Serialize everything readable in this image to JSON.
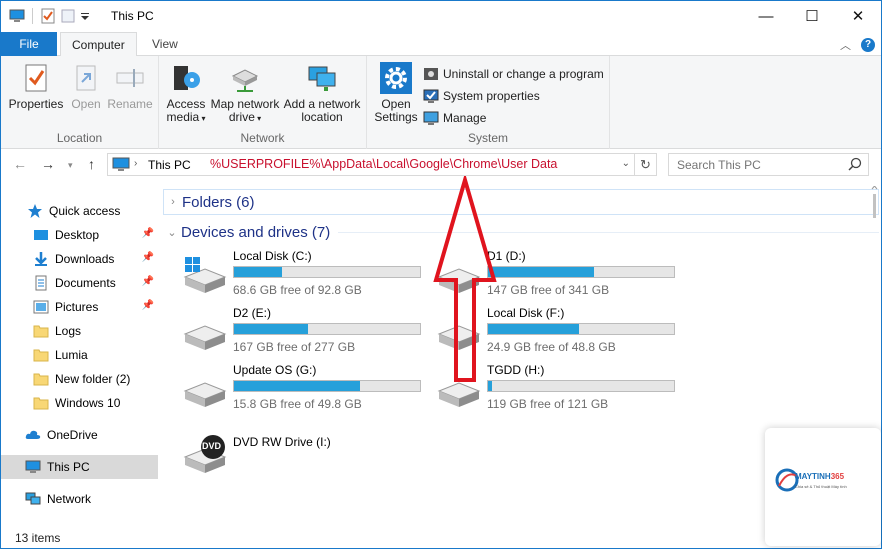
{
  "window": {
    "title": "This PC",
    "minimize": "—",
    "maximize": "☐",
    "close": "✕"
  },
  "tabs": {
    "file": "File",
    "computer": "Computer",
    "view": "View",
    "help": "?"
  },
  "ribbon": {
    "location": {
      "label": "Location",
      "properties": "Properties",
      "open": "Open",
      "rename": "Rename"
    },
    "network": {
      "label": "Network",
      "access_media": "Access media",
      "map_drive": "Map network drive",
      "add_location": "Add a network location"
    },
    "system": {
      "label": "System",
      "open_settings": "Open Settings",
      "uninstall": "Uninstall or change a program",
      "sys_props": "System properties",
      "manage": "Manage"
    }
  },
  "address": {
    "crumb": "This PC",
    "path": "%USERPROFILE%\\AppData\\Local\\Google\\Chrome\\User Data",
    "search_placeholder": "Search This PC"
  },
  "nav": {
    "quick_access": "Quick access",
    "items": [
      "Desktop",
      "Downloads",
      "Documents",
      "Pictures",
      "Logs",
      "Lumia",
      "New folder (2)",
      "Windows 10"
    ],
    "onedrive": "OneDrive",
    "this_pc": "This PC",
    "network": "Network"
  },
  "content": {
    "folders": "Folders (6)",
    "devices": "Devices and drives (7)",
    "drives": [
      {
        "name": "Local Disk (C:)",
        "free": "68.6 GB free of 92.8 GB",
        "used_fraction": 0.26
      },
      {
        "name": "D1 (D:)",
        "free": "147 GB free of 341 GB",
        "used_fraction": 0.57
      },
      {
        "name": "D2 (E:)",
        "free": "167 GB free of 277 GB",
        "used_fraction": 0.4
      },
      {
        "name": "Local Disk (F:)",
        "free": "24.9 GB free of 48.8 GB",
        "used_fraction": 0.49
      },
      {
        "name": "Update OS (G:)",
        "free": "15.8 GB free of 49.8 GB",
        "used_fraction": 0.68
      },
      {
        "name": "TGDD (H:)",
        "free": "119 GB free of 121 GB",
        "used_fraction": 0.02
      },
      {
        "name": "DVD RW Drive (I:)",
        "free": "",
        "used_fraction": null
      }
    ],
    "dvd_badge": "DVD"
  },
  "status": {
    "items": "13 items"
  },
  "watermark": {
    "brand_a": "MAYTINH",
    "brand_b": "365",
    "tagline": "Chia sẻ & Thủ thuật Máy tính"
  },
  "colors": {
    "accent": "#1979ca",
    "bar_fill": "#26a0da",
    "path_text": "#c8102e",
    "annotation": "#e0141e"
  }
}
